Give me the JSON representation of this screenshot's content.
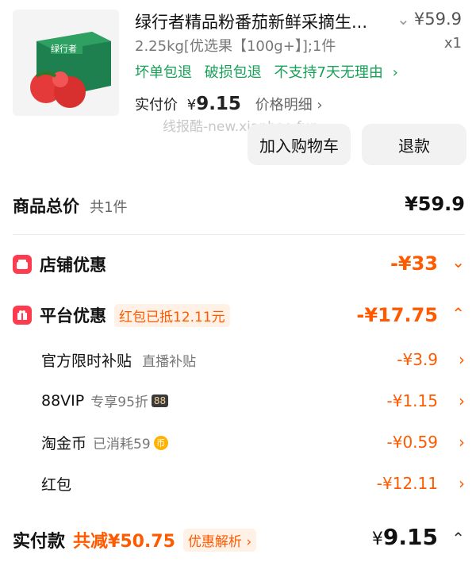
{
  "product": {
    "title": "绿行者精品粉番茄新鲜采摘生...",
    "price": "¥59.9",
    "spec": "2.25kg[优选果【100g+】];1件",
    "qty": "x1",
    "tags": [
      "坏单包退",
      "破损包退",
      "不支持7天无理由"
    ],
    "pay_label": "实付价",
    "pay_currency": "¥",
    "pay_value": "9.15",
    "price_detail": "价格明细",
    "box_text": "绿行者"
  },
  "watermark": "线报酷-new.xianbao.fun",
  "buttons": {
    "add_cart": "加入购物车",
    "refund": "退款"
  },
  "summary": {
    "total_label": "商品总价",
    "total_count": "共1件",
    "total_value": "¥59.9",
    "shop_discount_label": "店铺优惠",
    "shop_discount_value": "-¥33",
    "platform_discount_label": "平台优惠",
    "platform_pill": "红包已抵12.11元",
    "platform_discount_value": "-¥17.75",
    "items": [
      {
        "label": "官方限时补贴",
        "note": "直播补贴",
        "value": "-¥3.9"
      },
      {
        "label": "88VIP",
        "note": "专享95折",
        "badge": "88",
        "value": "-¥1.15"
      },
      {
        "label": "淘金币",
        "note": "已消耗59",
        "coin": "币",
        "value": "-¥0.59"
      },
      {
        "label": "红包",
        "note": "",
        "value": "-¥12.11"
      }
    ],
    "final_label": "实付款",
    "final_saved": "共减¥50.75",
    "final_pill": "优惠解析",
    "final_currency": "¥",
    "final_value": "9.15"
  },
  "colors": {
    "accent": "#ff5a00",
    "green": "#18a058",
    "red": "#ff3b4f"
  }
}
